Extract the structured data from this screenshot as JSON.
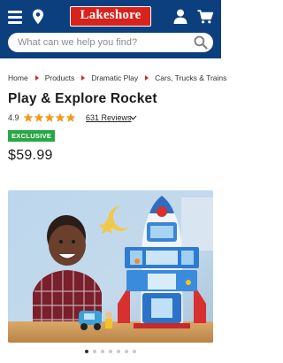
{
  "header": {
    "logo_text": "Lakeshore",
    "brand_color": "#0b3f7e",
    "logo_color": "#d7231c"
  },
  "search": {
    "placeholder": "What can we help you find?"
  },
  "breadcrumb": [
    "Home",
    "Products",
    "Dramatic Play",
    "Cars, Trucks & Trains"
  ],
  "product": {
    "title": "Play & Explore Rocket",
    "rating": "4.9",
    "stars_filled": 5,
    "reviews_label": "631 Reviews",
    "badge": "EXCLUSIVE",
    "price": "$59.99"
  },
  "gallery": {
    "total_images": 7,
    "active_index": 0
  },
  "colors": {
    "accent_red": "#d7231c",
    "badge_green": "#28a745",
    "star_orange": "#f29a1b"
  },
  "icons": [
    "hamburger-menu-icon",
    "location-pin-icon",
    "user-account-icon",
    "shopping-cart-icon",
    "search-icon",
    "star-icon",
    "chevron-down-icon"
  ]
}
